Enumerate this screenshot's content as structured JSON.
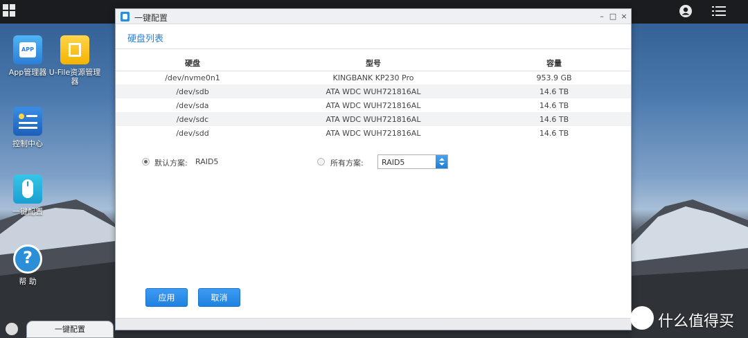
{
  "desktop": {
    "icons": [
      {
        "label": "App管理器"
      },
      {
        "label": "U-File资源管理器"
      },
      {
        "label": "控制中心"
      },
      {
        "label": "一键配置"
      },
      {
        "label": "帮 助"
      }
    ]
  },
  "window": {
    "title": "一键配置",
    "controls": {
      "minimize": "–",
      "maximize": "□",
      "close": "×"
    },
    "section_title": "硬盘列表",
    "table": {
      "headers": [
        "硬盘",
        "型号",
        "容量"
      ],
      "rows": [
        [
          "/dev/nvme0n1",
          "KINGBANK KP230 Pro",
          "953.9 GB"
        ],
        [
          "/dev/sdb",
          "ATA WDC WUH721816AL",
          "14.6 TB"
        ],
        [
          "/dev/sda",
          "ATA WDC WUH721816AL",
          "14.6 TB"
        ],
        [
          "/dev/sdc",
          "ATA WDC WUH721816AL",
          "14.6 TB"
        ],
        [
          "/dev/sdd",
          "ATA WDC WUH721816AL",
          "14.6 TB"
        ]
      ]
    },
    "raid": {
      "default_label": "默认方案:",
      "default_value": "RAID5",
      "all_label": "所有方案:",
      "select_value": "RAID5",
      "selected_option": "default"
    },
    "buttons": {
      "apply": "应用",
      "cancel": "取消"
    }
  },
  "taskbar": {
    "item_label": "一键配置"
  },
  "watermark": {
    "text": "什么值得买"
  },
  "colors": {
    "accent": "#1f82e0",
    "title_blue": "#2b7fd6"
  }
}
